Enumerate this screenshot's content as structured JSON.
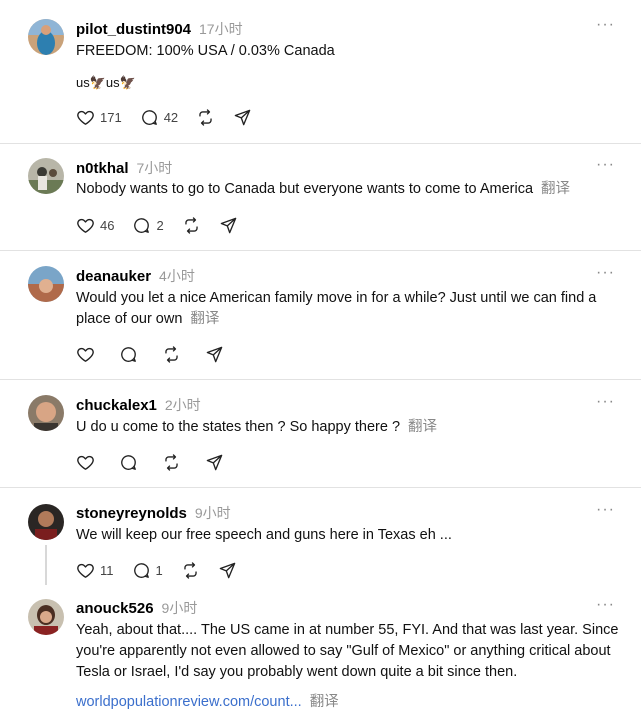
{
  "posts": [
    {
      "username": "pilot_dustint904",
      "time": "17小时",
      "text": "FREEDOM: 100% USA / 0.03% Canada",
      "extra": "us🦅us🦅",
      "likes": "171",
      "replies": "42",
      "translate": ""
    },
    {
      "username": "n0tkhal",
      "time": "7小时",
      "text": "Nobody wants to go to Canada but everyone wants to come to America",
      "likes": "46",
      "replies": "2",
      "translate": "翻译"
    },
    {
      "username": "deanauker",
      "time": "4小时",
      "text": "Would you let a nice American family move in for a while? Just until we can find a place of our own",
      "likes": "",
      "replies": "",
      "translate": "翻译"
    },
    {
      "username": "chuckalex1",
      "time": "2小时",
      "text": "U do u come to the states then ? So happy there ?",
      "likes": "",
      "replies": "",
      "translate": "翻译"
    },
    {
      "username": "stoneyreynolds",
      "time": "9小时",
      "text": "We will keep our free speech and guns here in Texas eh ...",
      "likes": "11",
      "replies": "1",
      "translate": ""
    },
    {
      "username": "anouck526",
      "time": "9小时",
      "text": "Yeah, about that.... The US came in at number 55, FYI. And that was last year. Since you're apparently not even allowed to say \"Gulf of Mexico\" or anything critical about Tesla or Israel, I'd say you probably went down quite a bit since then.",
      "link": "worldpopulationreview.com/count...",
      "likes": "",
      "replies": "",
      "translate": "翻译"
    }
  ],
  "more_glyph": "···",
  "icons": {
    "like": "heart-icon",
    "reply": "comment-icon",
    "repost": "repost-icon",
    "share": "send-icon"
  },
  "colors": {
    "link": "#3b6fcc",
    "muted": "#999999",
    "divider": "#e2e2e2"
  }
}
